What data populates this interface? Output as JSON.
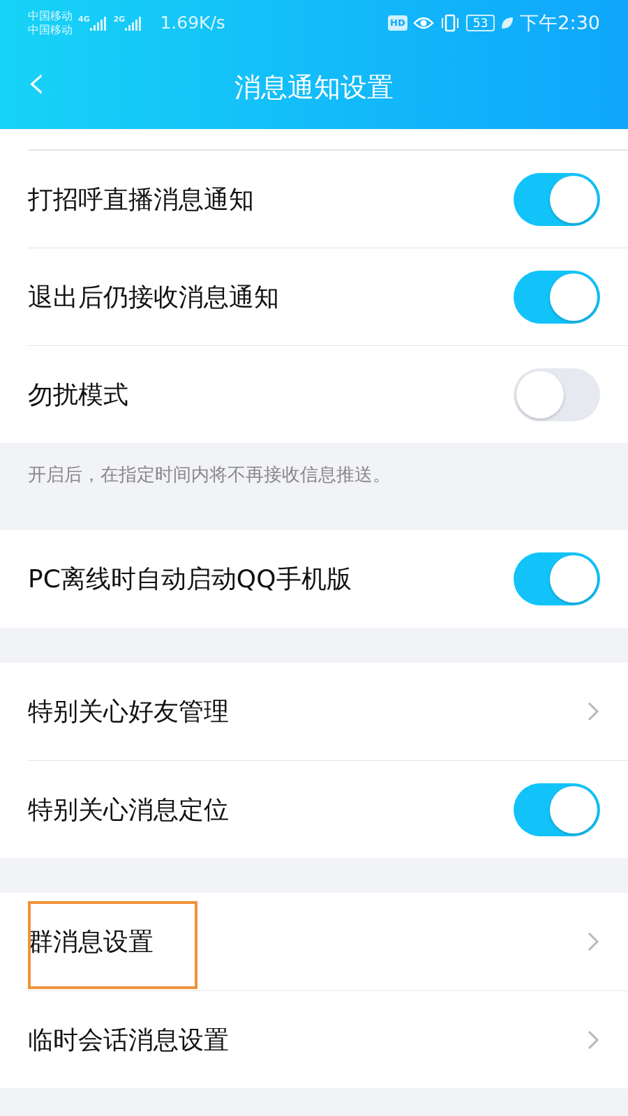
{
  "status_bar": {
    "carriers": [
      "中国移动",
      "中国移动"
    ],
    "network_1": "4G",
    "network_2": "2G",
    "speed": "1.69K/s",
    "hd": "HD",
    "battery": "53",
    "time": "下午2:30"
  },
  "header": {
    "back": "‹",
    "title": "消息通知设置"
  },
  "sections": [
    {
      "cut_top": true,
      "rows": [
        {
          "kind": "toggle",
          "label": "打招呼直播消息通知",
          "on": true,
          "highlighted": false
        },
        {
          "kind": "toggle",
          "label": "退出后仍接收消息通知",
          "on": true,
          "highlighted": false
        },
        {
          "kind": "toggle",
          "label": "勿扰模式",
          "on": false,
          "highlighted": false
        }
      ],
      "note": "开启后，在指定时间内将不再接收信息推送。"
    },
    {
      "rows": [
        {
          "kind": "toggle",
          "label": "PC离线时自动启动QQ手机版",
          "on": true,
          "highlighted": false
        }
      ]
    },
    {
      "rows": [
        {
          "kind": "link",
          "label": "特别关心好友管理",
          "highlighted": false
        },
        {
          "kind": "toggle",
          "label": "特别关心消息定位",
          "on": true,
          "highlighted": false
        }
      ]
    },
    {
      "rows": [
        {
          "kind": "link",
          "label": "群消息设置",
          "highlighted": true
        },
        {
          "kind": "link",
          "label": "临时会话消息设置",
          "highlighted": false
        }
      ]
    }
  ]
}
